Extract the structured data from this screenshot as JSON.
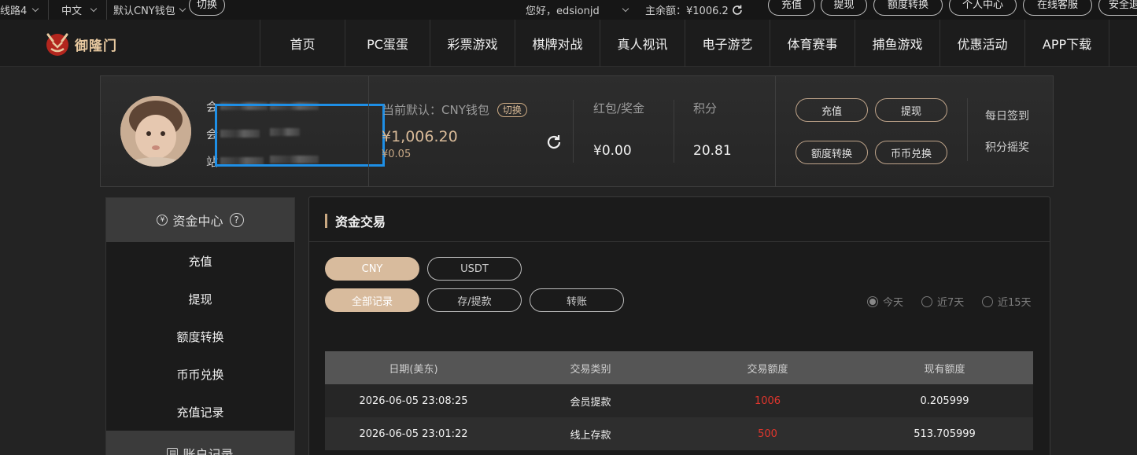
{
  "topbar": {
    "line": "线路4",
    "language": "中文",
    "wallet_default": "默认CNY钱包",
    "switch": "切换",
    "greeting": "您好，edsionjd",
    "main_balance": "主余额：¥1006.2",
    "buttons": [
      "充值",
      "提现",
      "额度转换",
      "个人中心",
      "在线客服",
      "安全退"
    ]
  },
  "brand": {
    "name": "御隆门"
  },
  "nav": {
    "items": [
      "首页",
      "PC蛋蛋",
      "彩票游戏",
      "棋牌对战",
      "真人视讯",
      "电子游艺",
      "体育赛事",
      "捕鱼游戏",
      "优惠活动",
      "APP下载"
    ]
  },
  "profile": {
    "row_prefixes": [
      "会",
      "会",
      "站"
    ],
    "wallet_label": "当前默认：CNY钱包",
    "switch_label": "切换",
    "balance": "¥1,006.20",
    "balance_sub": "¥0.05",
    "bonus_label": "红包/奖金",
    "bonus_value": "¥0.00",
    "points_label": "积分",
    "points_value": "20.81",
    "buttons": [
      "充值",
      "提现",
      "额度转换",
      "币币兑换"
    ],
    "links": [
      "每日签到",
      "积分摇奖"
    ]
  },
  "sidebar": {
    "title": "资金中心",
    "help": "?",
    "items": [
      "充值",
      "提现",
      "额度转换",
      "币币兑换",
      "充值记录"
    ],
    "section2": "账户记录"
  },
  "main": {
    "title": "资金交易",
    "currency_tabs": [
      "CNY",
      "USDT"
    ],
    "record_tabs": [
      "全部记录",
      "存/提款",
      "转账"
    ],
    "ranges": [
      "今天",
      "近7天",
      "近15天"
    ],
    "selected_range": "今天",
    "table": {
      "headers": [
        "日期(美东)",
        "交易类别",
        "交易额度",
        "现有额度"
      ],
      "rows": [
        [
          "2026-06-05 23:08:25",
          "会员提款",
          "1006",
          "0.205999"
        ],
        [
          "2026-06-05 23:01:22",
          "线上存款",
          "500",
          "513.705999"
        ]
      ]
    }
  },
  "colors": {
    "accent": "#d8bb9d",
    "amount_red": "#e0362d",
    "selection": "#1e8fe6"
  }
}
